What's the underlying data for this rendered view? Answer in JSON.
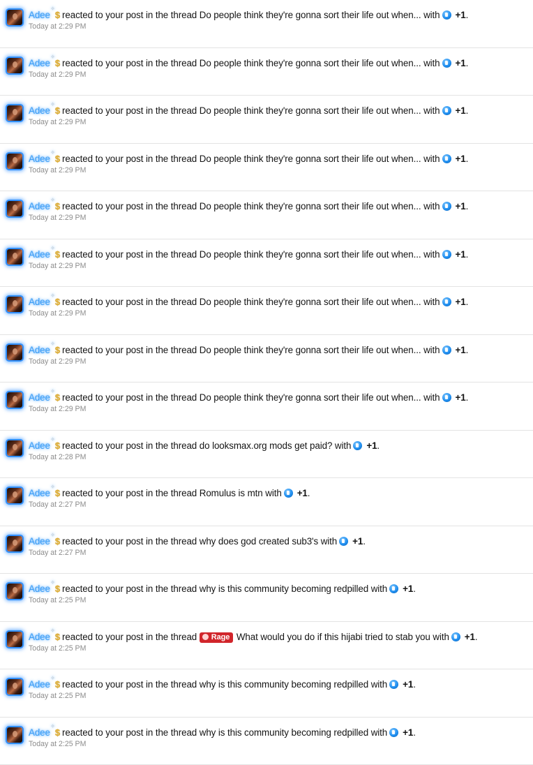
{
  "alerts": [
    {
      "user": "Adee",
      "pre": "reacted to your post in the thread",
      "prefix": "",
      "thread": "Do people think they're gonna sort their life out when...",
      "with": "with",
      "reaction": "+1",
      "period": ".",
      "time": "Today at 2:29 PM"
    },
    {
      "user": "Adee",
      "pre": "reacted to your post in the thread",
      "prefix": "",
      "thread": "Do people think they're gonna sort their life out when...",
      "with": "with",
      "reaction": "+1",
      "period": ".",
      "time": "Today at 2:29 PM"
    },
    {
      "user": "Adee",
      "pre": "reacted to your post in the thread",
      "prefix": "",
      "thread": "Do people think they're gonna sort their life out when...",
      "with": "with",
      "reaction": "+1",
      "period": ".",
      "time": "Today at 2:29 PM"
    },
    {
      "user": "Adee",
      "pre": "reacted to your post in the thread",
      "prefix": "",
      "thread": "Do people think they're gonna sort their life out when...",
      "with": "with",
      "reaction": "+1",
      "period": ".",
      "time": "Today at 2:29 PM"
    },
    {
      "user": "Adee",
      "pre": "reacted to your post in the thread",
      "prefix": "",
      "thread": "Do people think they're gonna sort their life out when...",
      "with": "with",
      "reaction": "+1",
      "period": ".",
      "time": "Today at 2:29 PM"
    },
    {
      "user": "Adee",
      "pre": "reacted to your post in the thread",
      "prefix": "",
      "thread": "Do people think they're gonna sort their life out when...",
      "with": "with",
      "reaction": "+1",
      "period": ".",
      "time": "Today at 2:29 PM"
    },
    {
      "user": "Adee",
      "pre": "reacted to your post in the thread",
      "prefix": "",
      "thread": "Do people think they're gonna sort their life out when...",
      "with": "with",
      "reaction": "+1",
      "period": ".",
      "time": "Today at 2:29 PM"
    },
    {
      "user": "Adee",
      "pre": "reacted to your post in the thread",
      "prefix": "",
      "thread": "Do people think they're gonna sort their life out when...",
      "with": "with",
      "reaction": "+1",
      "period": ".",
      "time": "Today at 2:29 PM"
    },
    {
      "user": "Adee",
      "pre": "reacted to your post in the thread",
      "prefix": "",
      "thread": "Do people think they're gonna sort their life out when...",
      "with": "with",
      "reaction": "+1",
      "period": ".",
      "time": "Today at 2:29 PM"
    },
    {
      "user": "Adee",
      "pre": "reacted to your post in the thread",
      "prefix": "",
      "thread": "do looksmax.org mods get paid?",
      "with": "with",
      "reaction": "+1",
      "period": ".",
      "time": "Today at 2:28 PM"
    },
    {
      "user": "Adee",
      "pre": "reacted to your post in the thread",
      "prefix": "",
      "thread": "Romulus is mtn",
      "with": "with",
      "reaction": "+1",
      "period": ".",
      "time": "Today at 2:27 PM"
    },
    {
      "user": "Adee",
      "pre": "reacted to your post in the thread",
      "prefix": "",
      "thread": "why does god created sub3's",
      "with": "with",
      "reaction": "+1",
      "period": ".",
      "time": "Today at 2:27 PM"
    },
    {
      "user": "Adee",
      "pre": "reacted to your post in the thread",
      "prefix": "",
      "thread": "why is this community becoming redpilled",
      "with": "with",
      "reaction": "+1",
      "period": ".",
      "time": "Today at 2:25 PM"
    },
    {
      "user": "Adee",
      "pre": "reacted to your post in the thread",
      "prefix": "Rage",
      "thread": "What would you do if this hijabi tried to stab you",
      "with": "with",
      "reaction": "+1",
      "period": ".",
      "time": "Today at 2:25 PM"
    },
    {
      "user": "Adee",
      "pre": "reacted to your post in the thread",
      "prefix": "",
      "thread": "why is this community becoming redpilled",
      "with": "with",
      "reaction": "+1",
      "period": ".",
      "time": "Today at 2:25 PM"
    },
    {
      "user": "Adee",
      "pre": "reacted to your post in the thread",
      "prefix": "",
      "thread": "why is this community becoming redpilled",
      "with": "with",
      "reaction": "+1",
      "period": ".",
      "time": "Today at 2:25 PM"
    }
  ],
  "colors": {
    "username": "#3c9df5",
    "prefix_rage": "#d1252b",
    "reaction": "#1f8ef0",
    "timestamp": "#8c8c8c"
  },
  "icons": {
    "user_badge": "coin-icon",
    "reaction": "like-icon",
    "prefix": "rage-face-icon",
    "avatar": "avatar"
  }
}
